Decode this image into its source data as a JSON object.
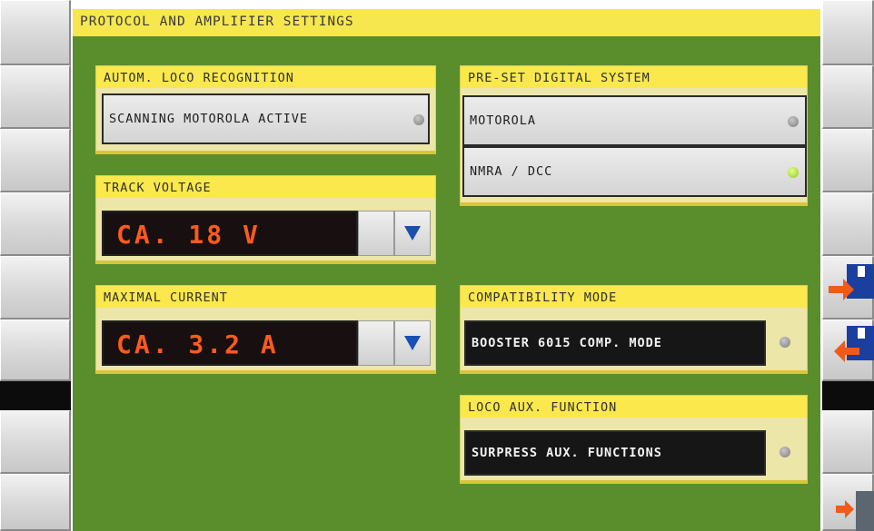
{
  "title": "PROTOCOL AND AMPLIFIER SETTINGS",
  "loco_recognition": {
    "header": "AUTOM. LOCO RECOGNITION",
    "status": "SCANNING MOTOROLA ACTIVE"
  },
  "track_voltage": {
    "header": "TRACK VOLTAGE",
    "value": "CA. 18 V"
  },
  "maximal_current": {
    "header": "MAXIMAL CURRENT",
    "value": "CA. 3.2 A"
  },
  "digital_system": {
    "header": "PRE-SET DIGITAL SYSTEM",
    "options": [
      {
        "label": "MOTOROLA",
        "active": false
      },
      {
        "label": "NMRA / DCC",
        "active": true
      }
    ]
  },
  "compatibility_mode": {
    "header": "COMPATIBILITY MODE",
    "option": "BOOSTER 6015 COMP. MODE"
  },
  "loco_aux_function": {
    "header": "LOCO AUX. FUNCTION",
    "option": "SURPRESS AUX. FUNCTIONS"
  },
  "colors": {
    "panel_green": "#5a8d2c",
    "header_yellow": "#fae84c",
    "readout_orange": "#ff5a1e",
    "led_active": "#8acd1c",
    "dropdown_arrow": "#1a4fb3",
    "nav_arrow": "#f05a1a"
  },
  "icons": {
    "dropdown": "triangle-down-icon",
    "right_side": [
      "export-arrow-icon",
      "import-arrow-icon",
      "exit-arrow-icon"
    ]
  }
}
